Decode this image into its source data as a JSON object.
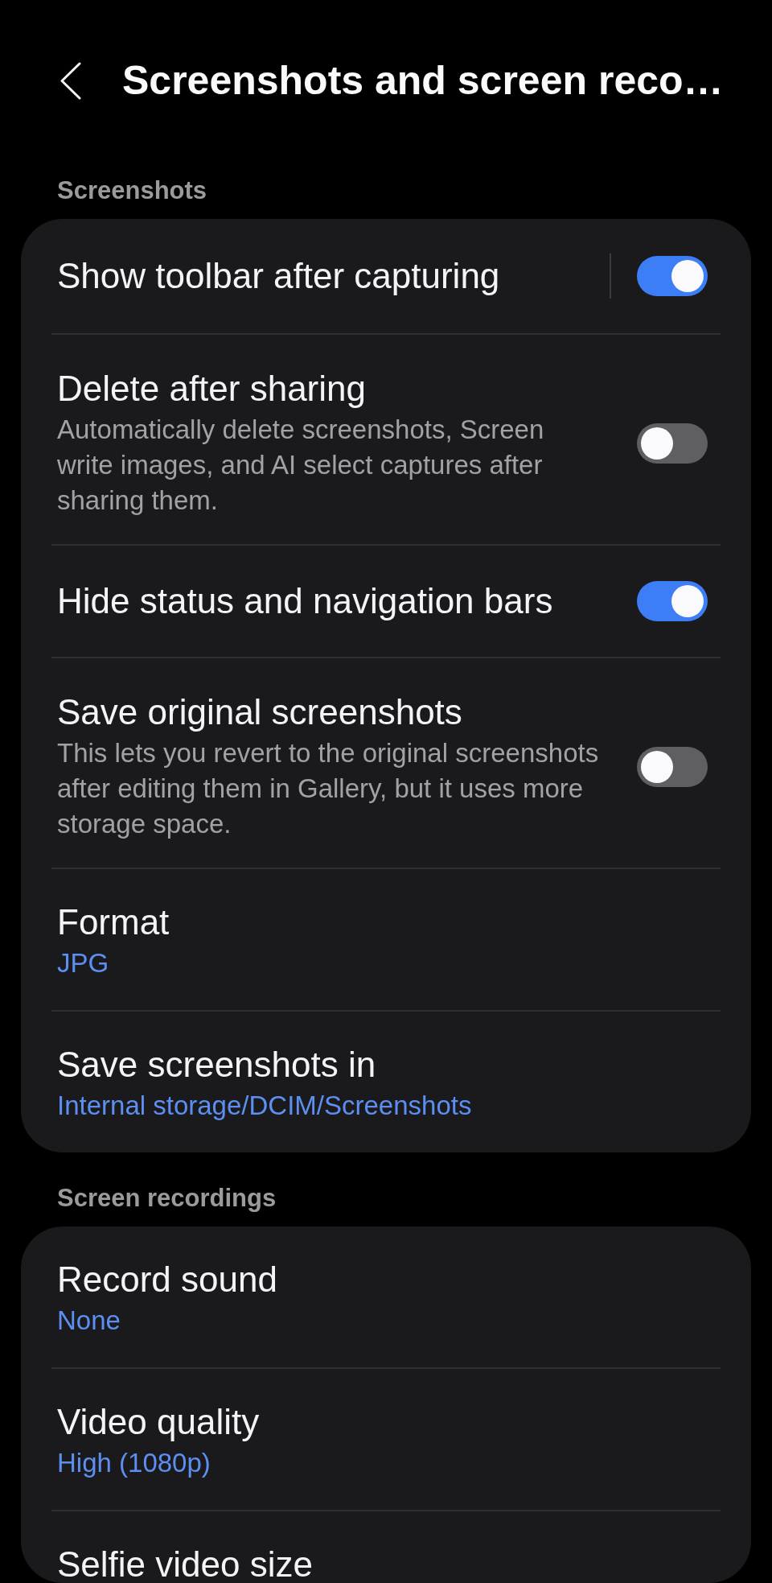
{
  "header": {
    "title": "Screenshots and screen reco…"
  },
  "sections": [
    {
      "title": "Screenshots",
      "items": [
        {
          "kind": "toggle",
          "title": "Show toolbar after capturing",
          "on": true,
          "split": true
        },
        {
          "kind": "toggle",
          "title": "Delete after sharing",
          "description": "Automatically delete screenshots, Screen write images, and AI select captures after sharing them.",
          "on": false,
          "split": false
        },
        {
          "kind": "toggle",
          "title": "Hide status and navigation bars",
          "on": true,
          "split": false
        },
        {
          "kind": "toggle",
          "title": "Save original screenshots",
          "description": "This lets you revert to the original screenshots after editing them in Gallery, but it uses more storage space.",
          "on": false,
          "split": false
        },
        {
          "kind": "value",
          "title": "Format",
          "value": "JPG"
        },
        {
          "kind": "value",
          "title": "Save screenshots in",
          "value": "Internal storage/DCIM/Screenshots"
        }
      ]
    },
    {
      "title": "Screen recordings",
      "items": [
        {
          "kind": "value",
          "title": "Record sound",
          "value": "None"
        },
        {
          "kind": "value",
          "title": "Video quality",
          "value": "High (1080p)"
        },
        {
          "kind": "value",
          "title": "Selfie video size"
        }
      ]
    }
  ]
}
